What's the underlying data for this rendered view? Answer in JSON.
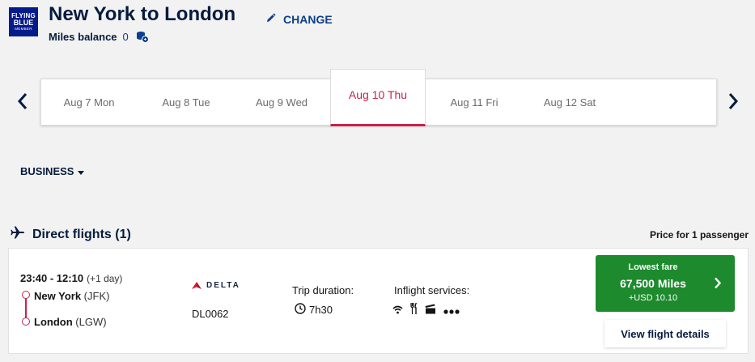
{
  "brand": {
    "line1": "FLYING",
    "line2": "BLUE",
    "line3": "MEMBER",
    "color": "#051b8c"
  },
  "header": {
    "title": "New York to London",
    "change_label": "CHANGE",
    "miles_label": "Miles balance",
    "miles_value": "0"
  },
  "date_tabs": [
    {
      "label": "Aug 7 Mon"
    },
    {
      "label": "Aug 8 Tue"
    },
    {
      "label": "Aug 9 Wed"
    },
    {
      "label": "Aug 10 Thu",
      "active": true
    },
    {
      "label": "Aug 11 Fri"
    },
    {
      "label": "Aug 12 Sat"
    }
  ],
  "cabin": {
    "label": "BUSINESS"
  },
  "section": {
    "title": "Direct flights (1)",
    "price_note": "Price for 1 passenger"
  },
  "flight": {
    "times": "23:40 - 12:10",
    "day_offset": "(+1 day)",
    "origin_city": "New York",
    "origin_code": "(JFK)",
    "dest_city": "London",
    "dest_code": "(LGW)",
    "airline": "DELTA",
    "flight_number": "DL0062",
    "duration_label": "Trip duration:",
    "duration": "7h30",
    "services_label": "Inflight services:",
    "services_icons": [
      "wifi-icon",
      "meal-icon",
      "entertainment-icon",
      "more-icon"
    ]
  },
  "fare": {
    "label": "Lowest fare",
    "miles": "67,500 Miles",
    "cash": "+USD 10.10",
    "color": "#1d8a2e"
  },
  "details_label": "View flight details",
  "colors": {
    "accent": "#c4244d",
    "navy": "#051b3e",
    "link": "#0b3e8c"
  }
}
